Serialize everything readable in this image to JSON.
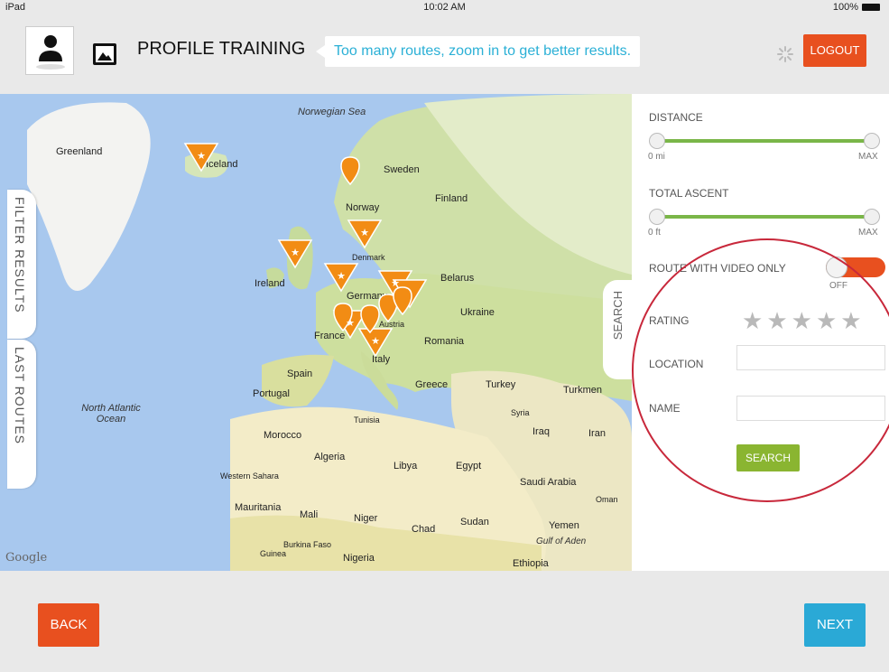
{
  "status_bar": {
    "device": "iPad",
    "time": "10:02 AM",
    "battery": "100%"
  },
  "header": {
    "title": "PROFILE TRAINING",
    "notice": "Too many routes, zoom in to get better results.",
    "logout_label": "LOGOUT"
  },
  "map": {
    "labels": [
      {
        "text": "Norwegian Sea",
        "kind": "sea"
      },
      {
        "text": "Greenland",
        "kind": "land"
      },
      {
        "text": "Iceland",
        "kind": "land"
      },
      {
        "text": "Sweden",
        "kind": "land"
      },
      {
        "text": "Finland",
        "kind": "land"
      },
      {
        "text": "Norway",
        "kind": "land"
      },
      {
        "text": "Denmark",
        "kind": "land"
      },
      {
        "text": "Belarus",
        "kind": "land"
      },
      {
        "text": "Ireland",
        "kind": "land"
      },
      {
        "text": "Germany",
        "kind": "land"
      },
      {
        "text": "Ukraine",
        "kind": "land"
      },
      {
        "text": "Austria",
        "kind": "land"
      },
      {
        "text": "France",
        "kind": "land"
      },
      {
        "text": "Romania",
        "kind": "land"
      },
      {
        "text": "Italy",
        "kind": "land"
      },
      {
        "text": "Spain",
        "kind": "land"
      },
      {
        "text": "Portugal",
        "kind": "land"
      },
      {
        "text": "Greece",
        "kind": "land"
      },
      {
        "text": "Turkey",
        "kind": "land"
      },
      {
        "text": "Turkmen",
        "kind": "land"
      },
      {
        "text": "North Atlantic Ocean",
        "kind": "sea"
      },
      {
        "text": "Tunisia",
        "kind": "land"
      },
      {
        "text": "Syria",
        "kind": "land"
      },
      {
        "text": "Iraq",
        "kind": "land"
      },
      {
        "text": "Iran",
        "kind": "land"
      },
      {
        "text": "Morocco",
        "kind": "land"
      },
      {
        "text": "Algeria",
        "kind": "land"
      },
      {
        "text": "Libya",
        "kind": "land"
      },
      {
        "text": "Egypt",
        "kind": "land"
      },
      {
        "text": "Saudi Arabia",
        "kind": "land"
      },
      {
        "text": "Western Sahara",
        "kind": "land"
      },
      {
        "text": "Oman",
        "kind": "land"
      },
      {
        "text": "Mauritania",
        "kind": "land"
      },
      {
        "text": "Mali",
        "kind": "land"
      },
      {
        "text": "Niger",
        "kind": "land"
      },
      {
        "text": "Chad",
        "kind": "land"
      },
      {
        "text": "Sudan",
        "kind": "land"
      },
      {
        "text": "Yemen",
        "kind": "land"
      },
      {
        "text": "Gulf of Aden",
        "kind": "sea"
      },
      {
        "text": "Burkina Faso",
        "kind": "land"
      },
      {
        "text": "Guinea",
        "kind": "land"
      },
      {
        "text": "Nigeria",
        "kind": "land"
      },
      {
        "text": "Ethiopia",
        "kind": "land"
      }
    ],
    "attribution": "Google",
    "marker_color": "#f28c14"
  },
  "tabs": {
    "filter_results": "FILTER RESULTS",
    "last_routes": "LAST ROUTES",
    "search": "SEARCH"
  },
  "filter_panel": {
    "distance": {
      "label": "DISTANCE",
      "min": "0 mi",
      "max": "MAX"
    },
    "total_ascent": {
      "label": "TOTAL ASCENT",
      "min": "0 ft",
      "max": "MAX"
    },
    "video_only": {
      "label": "ROUTE WITH VIDEO ONLY",
      "state": "OFF"
    },
    "rating": {
      "label": "RATING",
      "stars": 5
    },
    "location": {
      "label": "LOCATION",
      "value": ""
    },
    "name": {
      "label": "NAME",
      "value": ""
    },
    "search_label": "SEARCH"
  },
  "footer": {
    "back_label": "BACK",
    "next_label": "NEXT"
  },
  "colors": {
    "accent_orange": "#e8501f",
    "accent_blue": "#2aa9d6",
    "accent_green": "#8ab531",
    "annotation_red": "#c8283b"
  }
}
